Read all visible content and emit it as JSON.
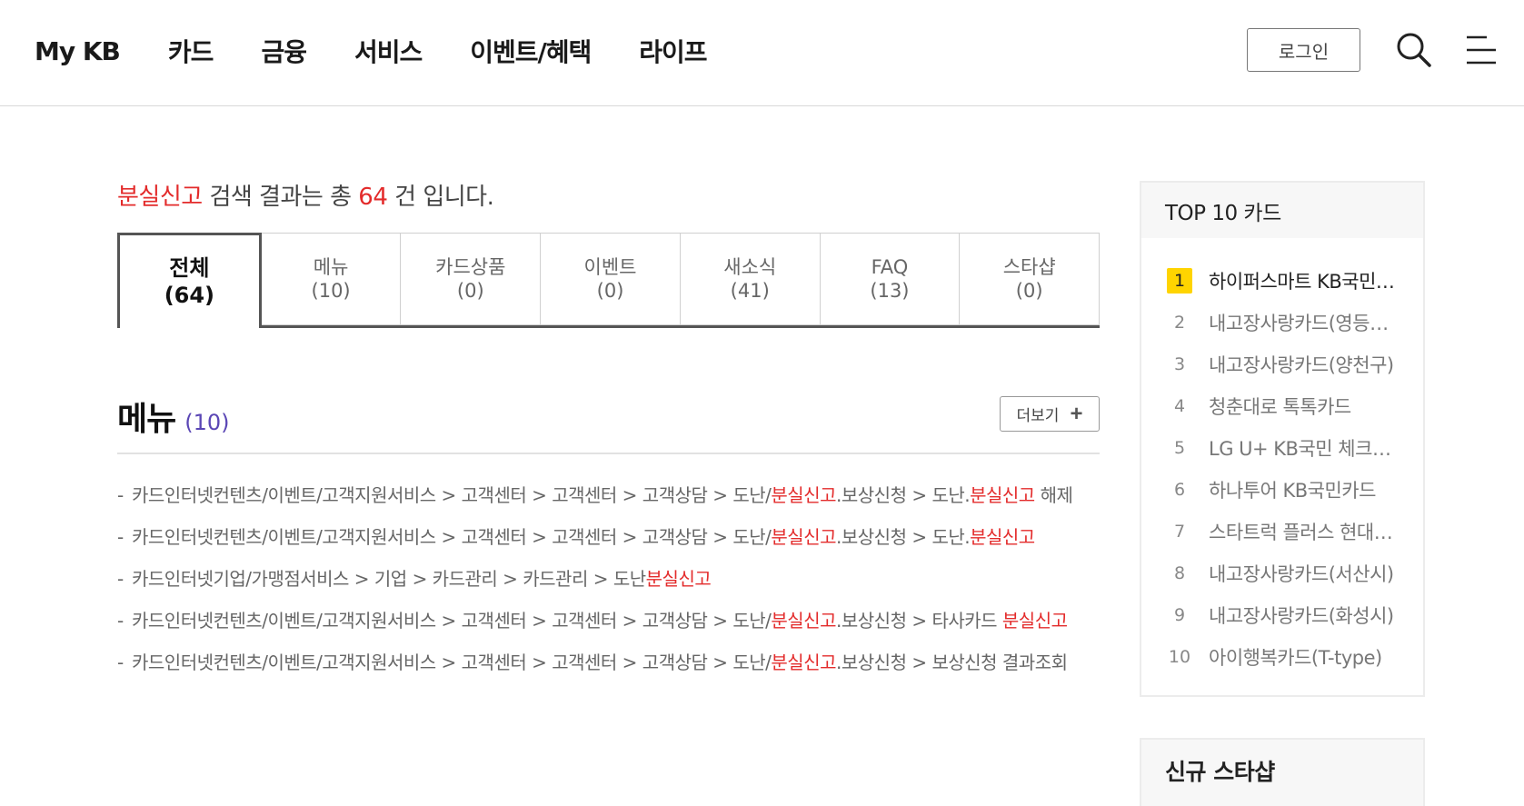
{
  "header": {
    "nav": [
      "My KB",
      "카드",
      "금융",
      "서비스",
      "이벤트/혜택",
      "라이프"
    ],
    "login_label": "로그인",
    "search_icon": "search-icon",
    "menu_icon": "hamburger-menu-icon"
  },
  "search_summary": {
    "keyword": "분실신고",
    "text_before_count": " 검색 결과는 총 ",
    "count": "64",
    "text_after_count": " 건 입니다."
  },
  "tabs": [
    {
      "label": "전체",
      "count": "(64)",
      "active": true
    },
    {
      "label": "메뉴",
      "count": "(10)",
      "active": false
    },
    {
      "label": "카드상품",
      "count": "(0)",
      "active": false
    },
    {
      "label": "이벤트",
      "count": "(0)",
      "active": false
    },
    {
      "label": "새소식",
      "count": "(41)",
      "active": false
    },
    {
      "label": "FAQ",
      "count": "(13)",
      "active": false
    },
    {
      "label": "스타샵",
      "count": "(0)",
      "active": false
    }
  ],
  "menu_section": {
    "title": "메뉴",
    "count": "(10)",
    "more_label": "더보기",
    "more_icon": "plus-icon",
    "highlight_color": "#e32b2b",
    "results": [
      "카드인터넷컨텐츠/이벤트/고객지원서비스 > 고객센터 > 고객센터 > 고객상담 > 도난/분실신고.보상신청 > 도난.분실신고 해제",
      "카드인터넷컨텐츠/이벤트/고객지원서비스 > 고객센터 > 고객센터 > 고객상담 > 도난/분실신고.보상신청 > 도난.분실신고",
      "카드인터넷기업/가맹점서비스 > 기업 > 카드관리 > 카드관리 > 도난분실신고",
      "카드인터넷컨텐츠/이벤트/고객지원서비스 > 고객센터 > 고객센터 > 고객상담 > 도난/분실신고.보상신청 > 타사카드 분실신고",
      "카드인터넷컨텐츠/이벤트/고객지원서비스 > 고객센터 > 고객센터 > 고객상담 > 도난/분실신고.보상신청 > 보상신청 결과조회"
    ]
  },
  "top10": {
    "title": "TOP 10 카드",
    "badge_color": "#ffd400",
    "items": [
      {
        "rank": "1",
        "name": "하이퍼스마트 KB국민카드"
      },
      {
        "rank": "2",
        "name": "내고장사랑카드(영등포구)"
      },
      {
        "rank": "3",
        "name": "내고장사랑카드(양천구)"
      },
      {
        "rank": "4",
        "name": "청춘대로 톡톡카드"
      },
      {
        "rank": "5",
        "name": "LG U+ KB국민 체크카드"
      },
      {
        "rank": "6",
        "name": "하나투어 KB국민카드"
      },
      {
        "rank": "7",
        "name": "스타트럭 플러스 현대카드"
      },
      {
        "rank": "8",
        "name": "내고장사랑카드(서산시)"
      },
      {
        "rank": "9",
        "name": "내고장사랑카드(화성시)"
      },
      {
        "rank": "10",
        "name": "아이행복카드(T-type)"
      }
    ]
  },
  "new_star": {
    "title": "신규 스타샵"
  }
}
